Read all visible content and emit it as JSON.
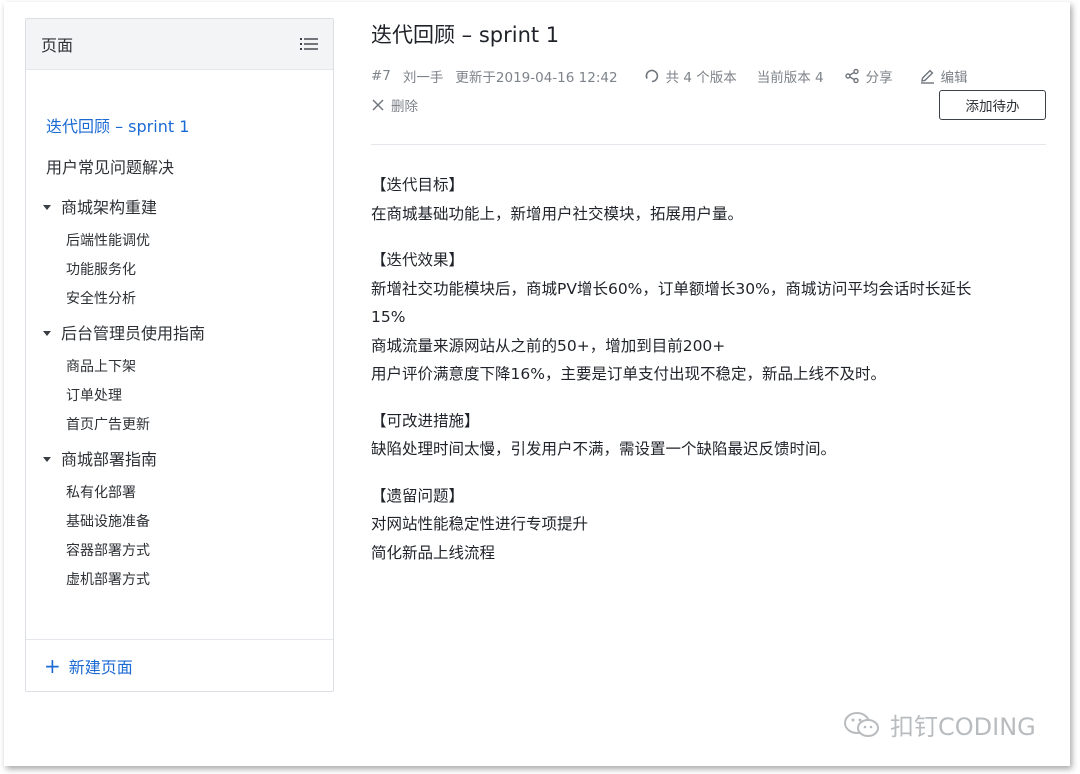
{
  "sidebar": {
    "title": "页面",
    "items": [
      {
        "label": "迭代回顾 – sprint 1"
      },
      {
        "label": "用户常见问题解决"
      }
    ],
    "groups": [
      {
        "label": "商城架构重建",
        "children": [
          "后端性能调优",
          "功能服务化",
          "安全性分析"
        ]
      },
      {
        "label": "后台管理员使用指南",
        "children": [
          "商品上下架",
          "订单处理",
          "首页广告更新"
        ]
      },
      {
        "label": "商城部署指南",
        "children": [
          "私有化部署",
          "基础设施准备",
          "容器部署方式",
          "虚机部署方式"
        ]
      }
    ],
    "new_page_label": "新建页面"
  },
  "page": {
    "title": "迭代回顾 – sprint 1",
    "id": "#7",
    "author": "刘一手",
    "updated": "更新于2019-04-16 12:42",
    "versions": "共 4 个版本",
    "current_version": "当前版本 4",
    "share_label": "分享",
    "edit_label": "编辑",
    "delete_label": "删除",
    "add_todo_label": "添加待办"
  },
  "content": {
    "sections": [
      {
        "heading": "【迭代目标】",
        "lines": [
          "在商城基础功能上，新增用户社交模块，拓展用户量。"
        ]
      },
      {
        "heading": "【迭代效果】",
        "lines": [
          "新增社交功能模块后，商城PV增长60%，订单额增长30%，商城访问平均会话时长延长",
          "15%",
          "商城流量来源网站从之前的50+，增加到目前200+",
          "用户评价满意度下降16%，主要是订单支付出现不稳定，新品上线不及时。"
        ]
      },
      {
        "heading": "【可改进措施】",
        "lines": [
          "缺陷处理时间太慢，引发用户不满，需设置一个缺陷最迟反馈时间。"
        ]
      },
      {
        "heading": "【遗留问题】",
        "lines": [
          "对网站性能稳定性进行专项提升",
          "简化新品上线流程"
        ]
      }
    ]
  },
  "watermark": {
    "text": "扣钉CODING"
  }
}
